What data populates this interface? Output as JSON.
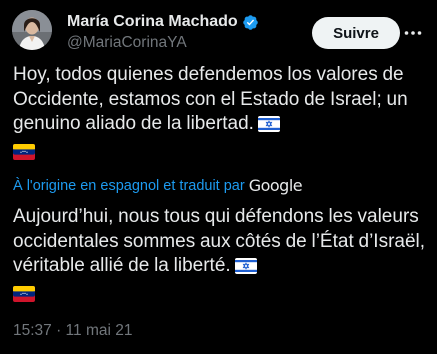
{
  "author": {
    "display_name": "María Corina Machado",
    "handle": "@MariaCorinaYA",
    "verified": true
  },
  "follow_button": {
    "label": "Suivre"
  },
  "tweet": {
    "text": "Hoy, todos quienes defendemos los valores de Occidente, estamos con el Estado de Israel; un genuino aliado de la libertad.",
    "emoji_1": "israel-flag",
    "emoji_2": "venezuela-flag"
  },
  "translation": {
    "notice": "À l'origine en espagnol et traduit par",
    "provider": "Google",
    "text": "Aujourd’hui, nous tous qui défendons les valeurs occidentales sommes aux côtés de l’État d’Israël, véritable allié de la liberté."
  },
  "timestamp": "15:37 · 11 mai 21",
  "colors": {
    "background": "#000000",
    "text": "#e7e9ea",
    "secondary": "#71767b",
    "link": "#1d9bf0",
    "verified": "#1d9bf0",
    "button_bg": "#eff3f4"
  }
}
